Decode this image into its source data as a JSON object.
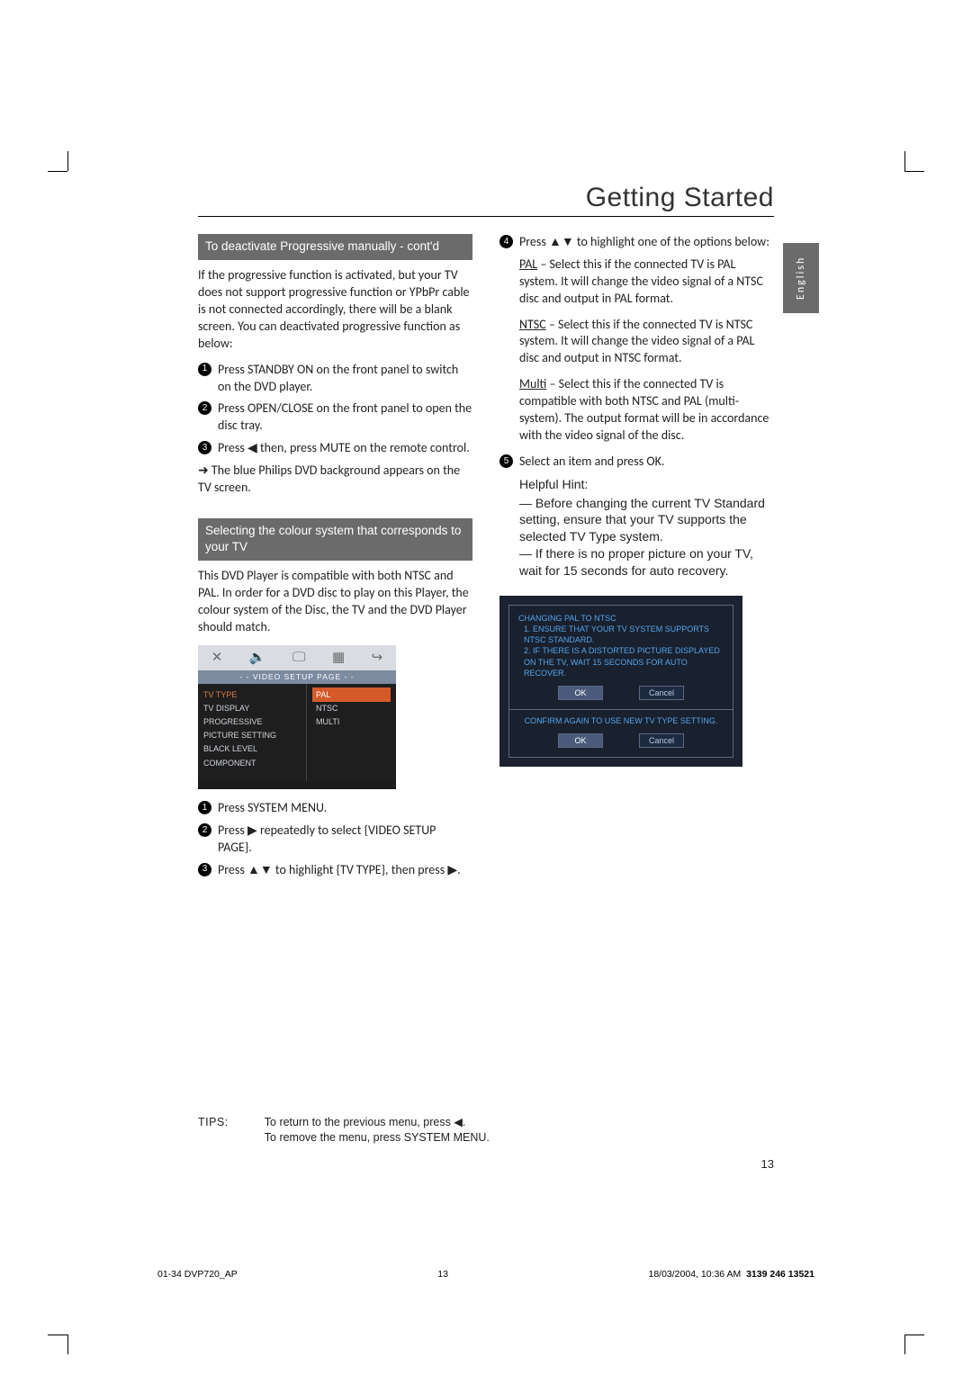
{
  "page": {
    "title": "Getting Started",
    "language_tab": "English",
    "page_number": "13"
  },
  "left": {
    "section1": {
      "heading": "To deactivate Progressive manually - cont'd",
      "intro": "If the progressive function is activated, but your TV does not support progressive function or YPbPr cable is not connected accordingly, there will be a blank screen. You can deactivated progressive function as below:",
      "steps": [
        "Press STANDBY ON on the front panel to switch on the DVD player.",
        "Press OPEN/CLOSE on the front panel to open the disc tray.",
        "Press ◀ then, press MUTE on the remote control."
      ],
      "step3_note": "➜ The blue Philips DVD background appears on the TV screen."
    },
    "section2": {
      "heading": "Selecting the colour system that corresponds to your TV",
      "intro": "This DVD Player is compatible with both NTSC and PAL. In order for a DVD disc to play on this Player, the colour system of the Disc, the TV and the DVD Player should match.",
      "osd": {
        "bar": "- -  VIDEO  SETUP  PAGE  - -",
        "tabs": [
          "✕",
          "🔈",
          "🖵",
          "▦",
          "↪"
        ],
        "menu": [
          "TV TYPE",
          "TV DISPLAY",
          "PROGRESSIVE",
          "PICTURE SETTING",
          "BLACK LEVEL",
          "COMPONENT"
        ],
        "opts": [
          "PAL",
          "NTSC",
          "MULTI"
        ]
      },
      "steps": [
        "Press SYSTEM MENU.",
        "Press ▶ repeatedly to select {VIDEO SETUP PAGE}.",
        "Press ▲▼ to highlight {TV TYPE}, then press ▶."
      ]
    }
  },
  "right": {
    "step4": "Press ▲▼ to highlight one of the options below:",
    "defs": {
      "pal_term": "PAL",
      "pal_text": " – Select this if the connected TV is PAL system. It will change the video signal of a NTSC disc and output in PAL format.",
      "ntsc_term": "NTSC",
      "ntsc_text": " – Select this if the connected TV is NTSC system. It will change the video signal of a PAL disc and output in NTSC format.",
      "multi_term": "Multi",
      "multi_text": " – Select this if the connected TV is compatible with both NTSC and PAL (multi-system). The output format will be in accordance with the video signal of the disc."
    },
    "step5": "Select an item and press OK.",
    "helpful_head": "Helpful Hint:",
    "helpful_1": "— Before changing the current TV Standard setting, ensure that your TV supports the selected TV Type system.",
    "helpful_2": "— If there is no proper picture on your TV, wait for 15 seconds for auto recovery.",
    "confirm1": {
      "title": "CHANGING PAL TO NTSC",
      "line1": "1. ENSURE THAT YOUR TV SYSTEM SUPPORTS NTSC STANDARD.",
      "line2": "2. IF THERE IS A DISTORTED PICTURE DISPLAYED ON THE TV, WAIT 15 SECONDS FOR AUTO RECOVER.",
      "ok": "OK",
      "cancel": "Cancel"
    },
    "confirm2": {
      "text": "CONFIRM AGAIN TO USE NEW TV TYPE SETTING.",
      "ok": "OK",
      "cancel": "Cancel"
    }
  },
  "tips": {
    "label": "TIPS:",
    "line1": "To return to the previous menu, press ◀.",
    "line2": "To remove the menu, press SYSTEM MENU."
  },
  "footer": {
    "left": "01-34 DVP720_AP",
    "mid": "13",
    "right_time": "18/03/2004, 10:36 AM",
    "right_code": "3139 246 13521"
  }
}
